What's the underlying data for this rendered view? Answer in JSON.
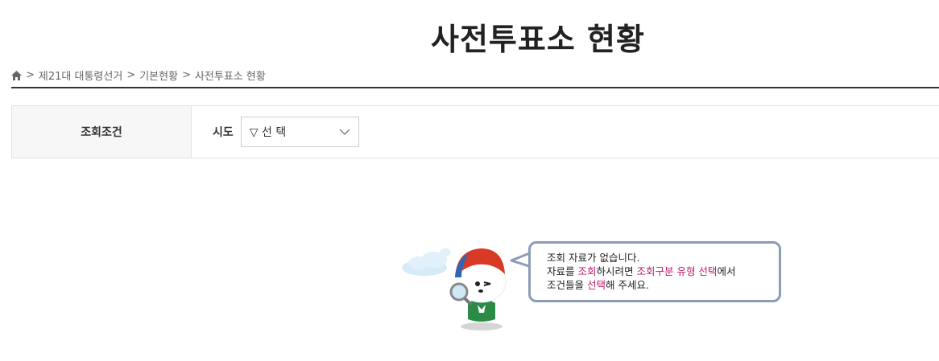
{
  "page_title": "사전투표소 현황",
  "breadcrumb": {
    "separator": ">",
    "items": [
      "제21대 대통령선거",
      "기본현황",
      "사전투표소 현황"
    ]
  },
  "search": {
    "label": "조회조건",
    "sido_label": "시도",
    "sido_select": "▽ 선 택"
  },
  "empty_message": {
    "line1": "조회 자료가 없습니다.",
    "line2_a": "자료를 ",
    "line2_b": "조회",
    "line2_c": "하시려면 ",
    "line2_d": "조회구분 유형 선택",
    "line2_e": "에서",
    "line3_a": "조건들을 ",
    "line3_b": "선택",
    "line3_c": "해 주세요."
  },
  "colors": {
    "highlight": "#c3186c",
    "bubble_border": "#8b9db4"
  }
}
